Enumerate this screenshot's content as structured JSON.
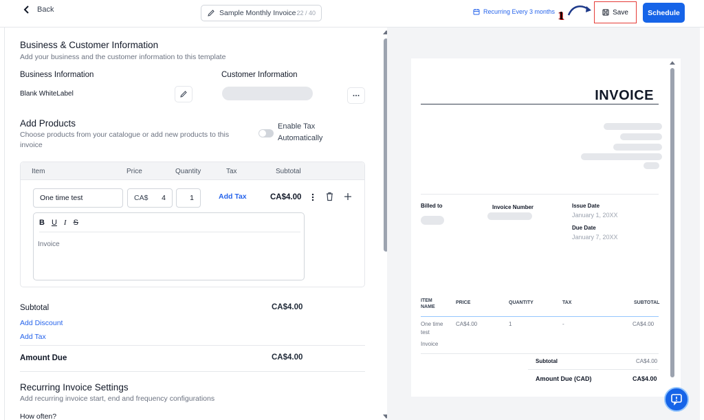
{
  "header": {
    "back_label": "Back",
    "invoice_name": "Sample Monthly Invoice",
    "char_count": "22 / 40",
    "recurring_label": "Recurring Every 3 months",
    "annotation_number": "1",
    "save_label": "Save",
    "schedule_label": "Schedule",
    "accent_color": "#1664e8",
    "highlight_color": "#e53935"
  },
  "business_section": {
    "title": "Business & Customer Information",
    "subtitle": "Add your business and the customer information to this template",
    "business_heading": "Business Information",
    "business_name": "Blank WhiteLabel",
    "customer_heading": "Customer Information"
  },
  "products_section": {
    "title": "Add Products",
    "subtitle_line1": "Choose products from your catalogue or add new products to this",
    "subtitle_line2": "invoice",
    "tax_toggle_line1": "Enable Tax",
    "tax_toggle_line2": "Automatically",
    "tax_toggle_on": false,
    "columns": [
      "Item",
      "Price",
      "Quantity",
      "Tax",
      "Subtotal"
    ],
    "row": {
      "item": "One time test",
      "currency": "CA$",
      "price": "4",
      "quantity": "1",
      "add_tax": "Add Tax",
      "subtotal": "CA$4.00"
    },
    "editor_tools": [
      "B",
      "U",
      "I",
      "S"
    ],
    "description": "Invoice"
  },
  "totals": {
    "subtotal_label": "Subtotal",
    "subtotal_value": "CA$4.00",
    "add_discount": "Add Discount",
    "add_tax": "Add Tax",
    "amount_due_label": "Amount Due",
    "amount_due_value": "CA$4.00"
  },
  "recurring_section": {
    "title": "Recurring Invoice Settings",
    "subtitle": "Add recurring invoice start, end and frequency configurations",
    "how_often": "How often?"
  },
  "preview": {
    "title": "INVOICE",
    "billed_to": "Billed to",
    "invoice_number": "Invoice Number",
    "issue_date_label": "Issue Date",
    "issue_date": "January 1, 20XX",
    "due_date_label": "Due Date",
    "due_date": "January 7, 20XX",
    "col_item": "ITEM NAME",
    "col_price": "PRICE",
    "col_quantity": "QUANTITY",
    "col_tax": "TAX",
    "col_subtotal": "SUBTOTAL",
    "row_item_line1": "One time",
    "row_item_line2": "test",
    "row_price": "CA$4.00",
    "row_quantity": "1",
    "row_tax": "-",
    "row_subtotal": "CA$4.00",
    "row_description": "Invoice",
    "subtotal_label": "Subtotal",
    "subtotal_value": "CA$4.00",
    "amount_due_label": "Amount Due (CAD)",
    "amount_due_value": "CA$4.00"
  }
}
